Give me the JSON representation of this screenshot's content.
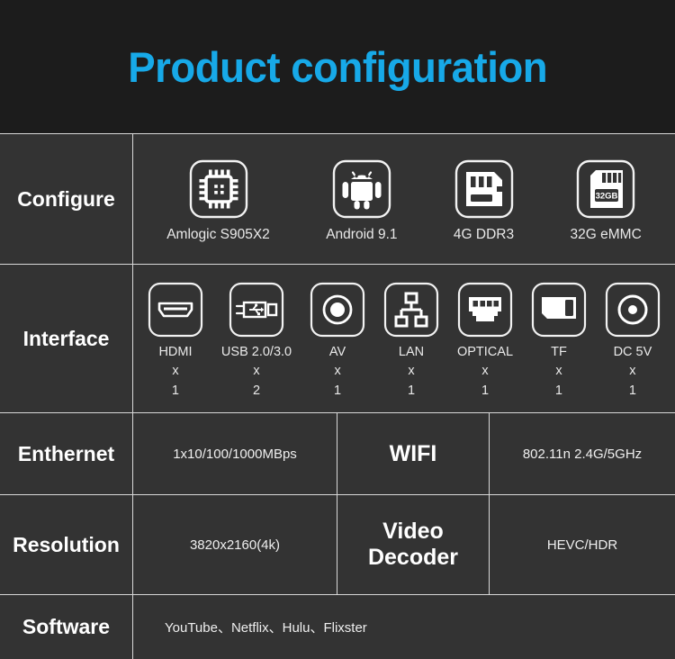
{
  "header": {
    "title": "Product configuration",
    "title_color": "#17a9e8",
    "background": "#1c1c1c"
  },
  "table": {
    "background": "#333333",
    "border_color": "#d8d8d8",
    "rows": [
      {
        "label": "Configure",
        "type": "icons",
        "items": [
          {
            "icon": "cpu-chip-icon",
            "caption": "Amlogic S905X2"
          },
          {
            "icon": "android-robot-icon",
            "caption": "Android 9.1"
          },
          {
            "icon": "memory-card-icon",
            "caption": "4G DDR3"
          },
          {
            "icon": "sd-card-32gb-icon",
            "caption": "32G eMMC",
            "icon_text": "32GB"
          }
        ]
      },
      {
        "label": "Interface",
        "type": "icons",
        "items": [
          {
            "icon": "hdmi-port-icon",
            "caption": "HDMI",
            "qty_x": "x",
            "qty": "1"
          },
          {
            "icon": "usb-plug-icon",
            "caption": "USB 2.0/3.0",
            "qty_x": "x",
            "qty": "2"
          },
          {
            "icon": "av-jack-icon",
            "caption": "AV",
            "qty_x": "x",
            "qty": "1"
          },
          {
            "icon": "lan-network-icon",
            "caption": "LAN",
            "qty_x": "x",
            "qty": "1"
          },
          {
            "icon": "optical-rj45-icon",
            "caption": "OPTICAL",
            "qty_x": "x",
            "qty": "1"
          },
          {
            "icon": "tf-card-icon",
            "caption": "TF",
            "qty_x": "x",
            "qty": "1"
          },
          {
            "icon": "dc-power-icon",
            "caption": "DC 5V",
            "qty_x": "x",
            "qty": "1"
          }
        ]
      },
      {
        "label": "Enthernet",
        "type": "split",
        "value_a": "1x10/100/1000MBps",
        "label_b": "WIFI",
        "value_c": "802.11n 2.4G/5GHz"
      },
      {
        "label": "Resolution",
        "type": "split",
        "value_a": "3820x2160(4k)",
        "label_b": "Video Decoder",
        "label_b_line1": "Video",
        "label_b_line2": "Decoder",
        "value_c": "HEVC/HDR"
      },
      {
        "label": "Software",
        "type": "text",
        "value": "YouTube、Netflix、Hulu、Flixster"
      }
    ]
  }
}
